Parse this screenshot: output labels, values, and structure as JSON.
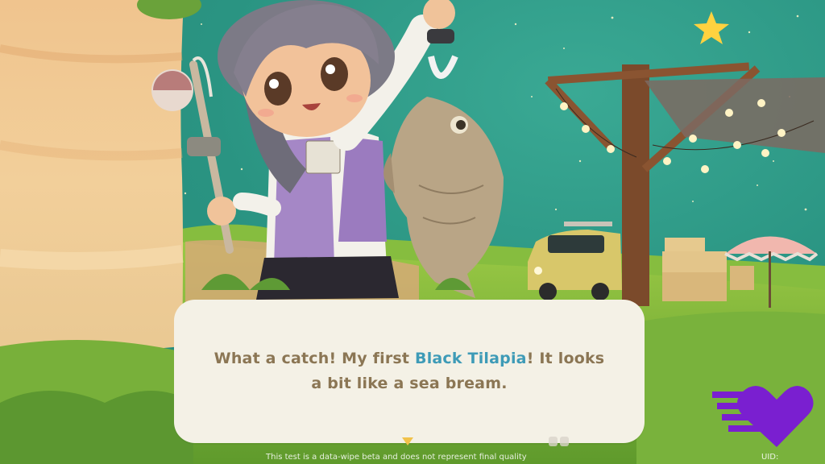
{
  "dialog": {
    "text_before": "What a catch! My first ",
    "highlight": "Black Tilapia",
    "text_after": "! It looks a bit like a sea bream."
  },
  "footer": {
    "disclaimer": "This test is a data-wipe beta and does not represent final quality",
    "uid_label": "UID:"
  },
  "icons": {
    "advance": "advance-arrow-icon",
    "menu": "menu-dots-icon",
    "watermark": "heart-speed-logo-icon",
    "star": "star-icon"
  },
  "colors": {
    "sky": "#2a9482",
    "dialog_bg": "#f4f1e6",
    "dialog_text": "#8b7654",
    "highlight": "#3e9bb7",
    "watermark": "#7a1fd0"
  }
}
